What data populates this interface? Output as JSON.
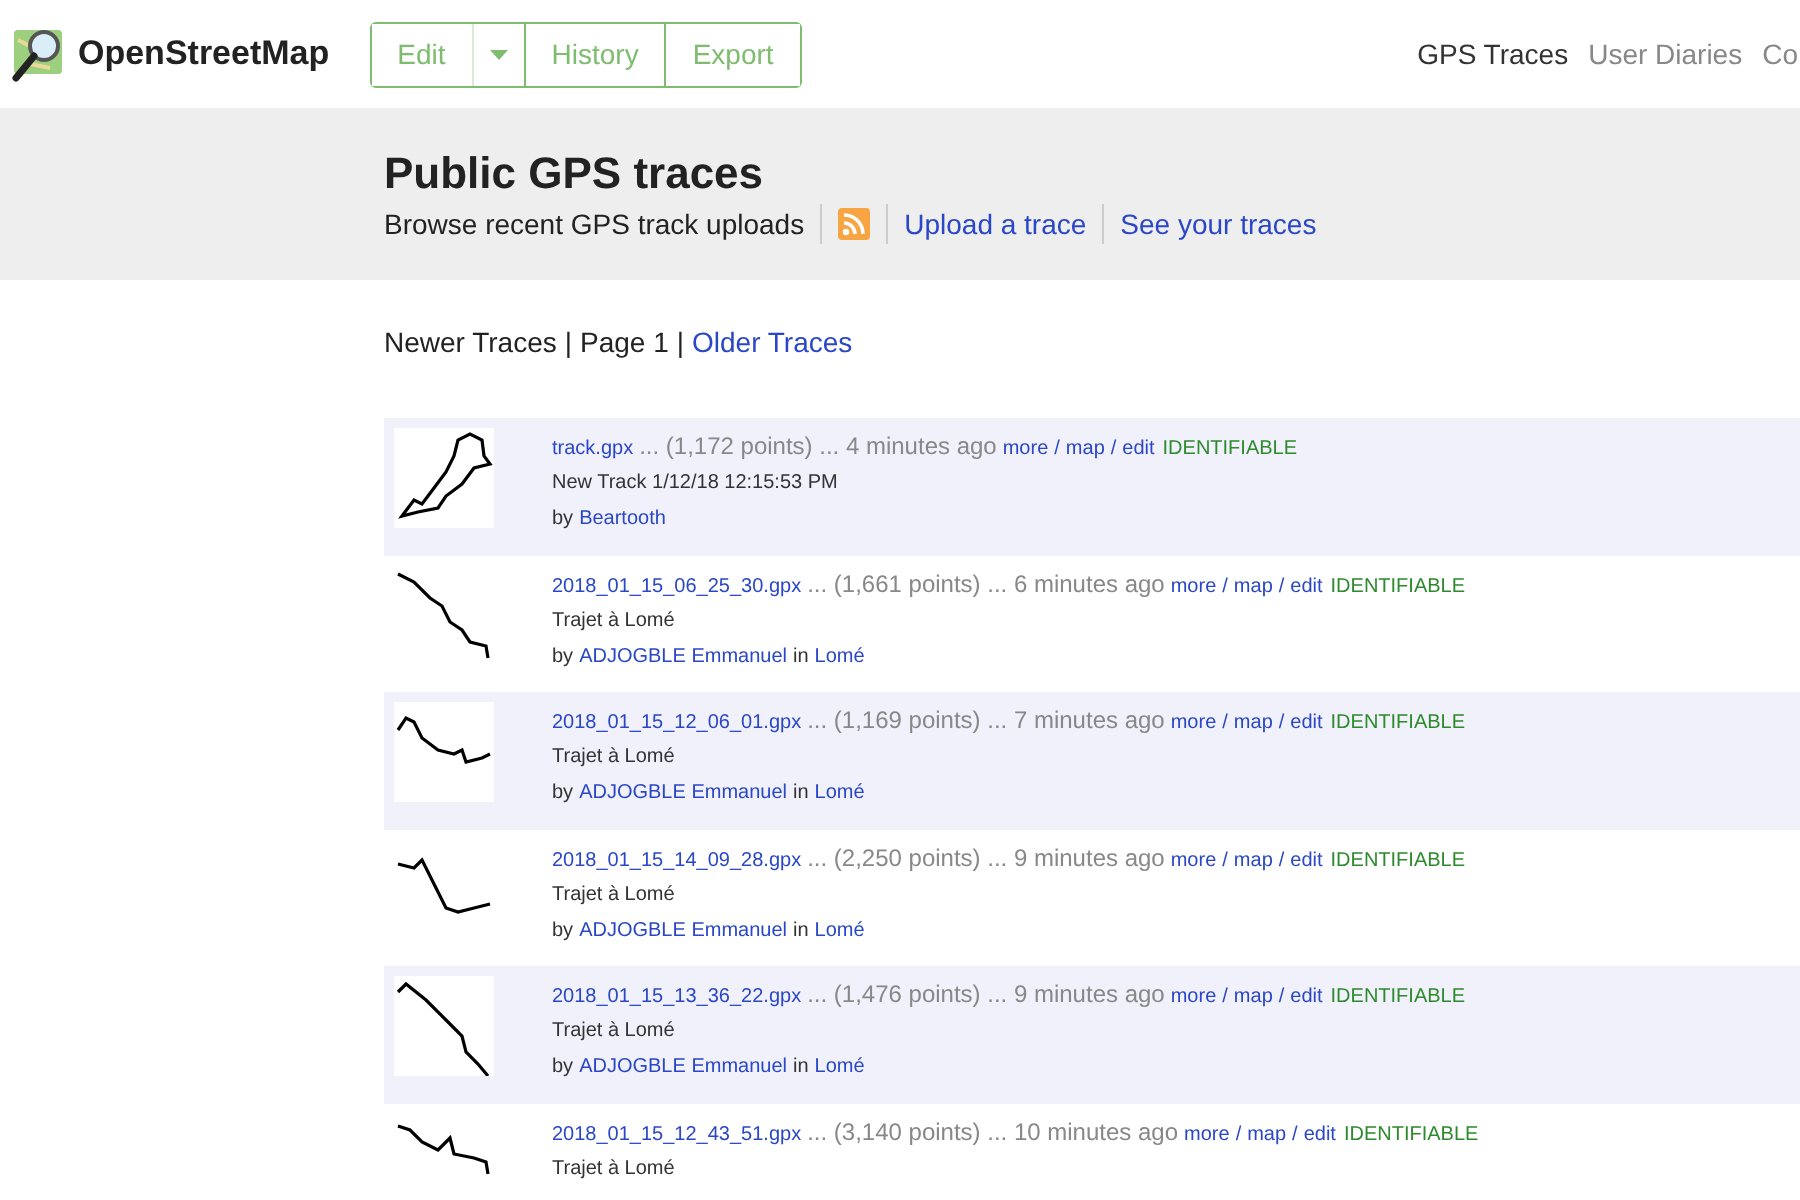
{
  "header": {
    "logo_text": "OpenStreetMap",
    "edit_buttons": [
      {
        "label": "Edit",
        "kind": "button"
      },
      {
        "kind": "caret"
      },
      {
        "label": "History",
        "kind": "button"
      },
      {
        "label": "Export",
        "kind": "button"
      }
    ],
    "nav": [
      {
        "label": "GPS Traces",
        "selected": true
      },
      {
        "label": "User Diaries",
        "selected": false
      },
      {
        "label": "Co",
        "selected": false
      }
    ]
  },
  "banner": {
    "title": "Public GPS traces",
    "subtitle": "Browse recent GPS track uploads",
    "links": [
      "Upload a trace",
      "See your traces"
    ]
  },
  "pager": {
    "newer": "Newer Traces",
    "separator": "|",
    "page": "Page 1",
    "older": "Older Traces"
  },
  "link_separator": "/",
  "traces": [
    {
      "file": "track.gpx",
      "meta": "... (1,172 points) ... 4 minutes ago",
      "links": [
        "more",
        "map",
        "edit"
      ],
      "visibility": "IDENTIFIABLE",
      "description": "New Track 1/12/18 12:15:53 PM",
      "by": "by",
      "user": "Beartooth"
    },
    {
      "file": "2018_01_15_06_25_30.gpx",
      "meta": "... (1,661 points) ... 6 minutes ago",
      "links": [
        "more",
        "map",
        "edit"
      ],
      "visibility": "IDENTIFIABLE",
      "description": "Trajet à Lomé",
      "by": "by",
      "user": "ADJOGBLE Emmanuel",
      "in": "in",
      "location": "Lomé"
    },
    {
      "file": "2018_01_15_12_06_01.gpx",
      "meta": "... (1,169 points) ... 7 minutes ago",
      "links": [
        "more",
        "map",
        "edit"
      ],
      "visibility": "IDENTIFIABLE",
      "description": "Trajet à Lomé",
      "by": "by",
      "user": "ADJOGBLE Emmanuel",
      "in": "in",
      "location": "Lomé"
    },
    {
      "file": "2018_01_15_14_09_28.gpx",
      "meta": "... (2,250 points) ... 9 minutes ago",
      "links": [
        "more",
        "map",
        "edit"
      ],
      "visibility": "IDENTIFIABLE",
      "description": "Trajet à Lomé",
      "by": "by",
      "user": "ADJOGBLE Emmanuel",
      "in": "in",
      "location": "Lomé"
    },
    {
      "file": "2018_01_15_13_36_22.gpx",
      "meta": "... (1,476 points) ... 9 minutes ago",
      "links": [
        "more",
        "map",
        "edit"
      ],
      "visibility": "IDENTIFIABLE",
      "description": "Trajet à Lomé",
      "by": "by",
      "user": "ADJOGBLE Emmanuel",
      "in": "in",
      "location": "Lomé"
    },
    {
      "file": "2018_01_15_12_43_51.gpx",
      "meta": "... (3,140 points) ... 10 minutes ago",
      "links": [
        "more",
        "map",
        "edit"
      ],
      "visibility": "IDENTIFIABLE",
      "description": "Trajet à Lomé"
    }
  ]
}
